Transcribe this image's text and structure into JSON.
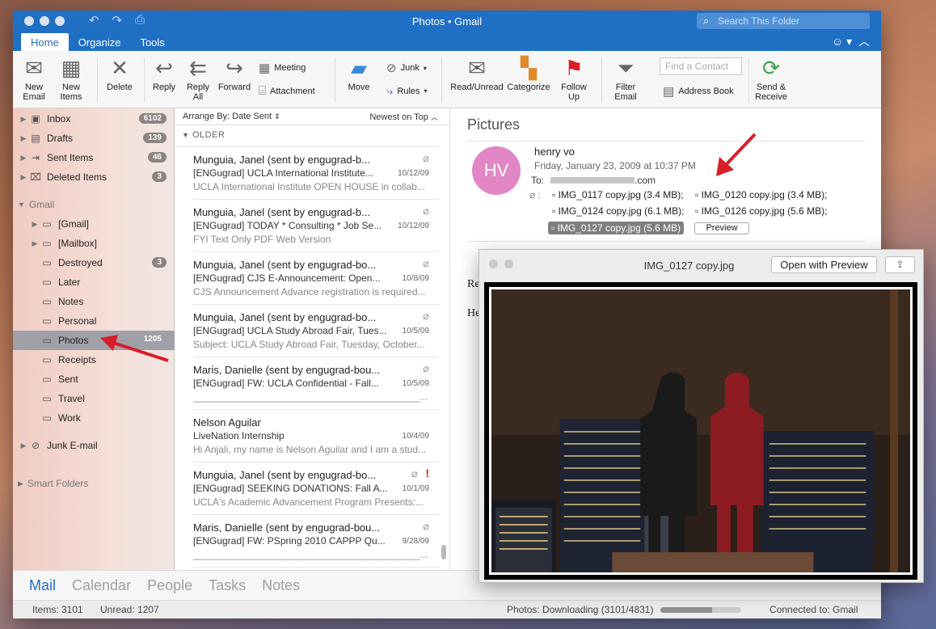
{
  "window": {
    "title": "Photos • Gmail",
    "search_placeholder": "Search This Folder"
  },
  "tabs": [
    "Home",
    "Organize",
    "Tools"
  ],
  "ribbon": {
    "new_email": "New\nEmail",
    "new_items": "New\nItems",
    "delete": "Delete",
    "reply": "Reply",
    "reply_all": "Reply\nAll",
    "forward": "Forward",
    "meeting": "Meeting",
    "attachment": "Attachment",
    "move": "Move",
    "junk": "Junk",
    "rules": "Rules",
    "read_unread": "Read/Unread",
    "categorize": "Categorize",
    "follow_up": "Follow\nUp",
    "filter_email": "Filter\nEmail",
    "find_contact_placeholder": "Find a Contact",
    "address_book": "Address Book",
    "send_receive": "Send &\nReceive"
  },
  "sidebar": {
    "top": [
      {
        "label": "Inbox",
        "count": "6102"
      },
      {
        "label": "Drafts",
        "count": "139"
      },
      {
        "label": "Sent Items",
        "count": "46"
      },
      {
        "label": "Deleted Items",
        "count": "3"
      }
    ],
    "gmail_label": "Gmail",
    "gmail": [
      {
        "label": "[Gmail]",
        "count": ""
      },
      {
        "label": "[Mailbox]",
        "count": ""
      },
      {
        "label": "Destroyed",
        "count": "3"
      },
      {
        "label": "Later",
        "count": ""
      },
      {
        "label": "Notes",
        "count": ""
      },
      {
        "label": "Personal",
        "count": ""
      },
      {
        "label": "Photos",
        "count": "1205"
      },
      {
        "label": "Receipts",
        "count": ""
      },
      {
        "label": "Sent",
        "count": ""
      },
      {
        "label": "Travel",
        "count": ""
      },
      {
        "label": "Work",
        "count": ""
      }
    ],
    "junk": "Junk E-mail",
    "smart": "Smart Folders"
  },
  "list": {
    "arrange": "Arrange By: Date Sent",
    "sort": "Newest on Top",
    "group": "OLDER",
    "messages": [
      {
        "from": "Munguia, Janel (sent by engugrad-b...",
        "subject": "[ENGugrad] UCLA International Institute...",
        "date": "10/12/09",
        "preview": "UCLA International Institute OPEN HOUSE in collab..."
      },
      {
        "from": "Munguia, Janel (sent by engugrad-b...",
        "subject": "[ENGugrad] TODAY * Consulting * Job Se...",
        "date": "10/12/09",
        "preview": "FYI Text Only PDF Web Version"
      },
      {
        "from": "Munguia, Janel (sent by engugrad-bo...",
        "subject": "[ENGugrad] CJS E-Announcement: Open...",
        "date": "10/8/09",
        "preview": "CJS Announcement Advance registration is required..."
      },
      {
        "from": "Munguia, Janel (sent by engugrad-bo...",
        "subject": "[ENGugrad] UCLA Study Abroad Fair, Tues...",
        "date": "10/5/09",
        "preview": "Subject: UCLA Study Abroad Fair, Tuesday, October..."
      },
      {
        "from": "Maris, Danielle (sent by engugrad-bou...",
        "subject": "[ENGugrad] FW: UCLA Confidential - Fall...",
        "date": "10/5/09",
        "preview": "__________________________________________..."
      },
      {
        "from": "Nelson Aguilar",
        "subject": "LiveNation Internship",
        "date": "10/4/09",
        "preview": "Hi Anjali, my name is Nelson Aguilar and I am a stud..."
      },
      {
        "from": "Munguia, Janel (sent by engugrad-bo...",
        "subject": "[ENGugrad] SEEKING DONATIONS: Fall A...",
        "date": "10/1/09",
        "preview": "UCLA's Academic Advancement Program Presents:..."
      },
      {
        "from": "Maris, Danielle (sent by engugrad-bou...",
        "subject": "[ENGugrad] FW: PSpring 2010 CAPPP Qu...",
        "date": "9/28/09",
        "preview": "__________________________________________..."
      }
    ]
  },
  "reading": {
    "subject": "Pictures",
    "initials": "HV",
    "sender": "henry vo",
    "date": "Friday, January 23, 2009 at 10:37 PM",
    "to_label": "To:",
    "to_domain": ".com",
    "attachments": [
      "IMG_0117 copy.jpg (3.4 MB);",
      "IMG_0120 copy.jpg (3.4 MB);",
      "IMG_0124 copy.jpg (6.1 MB);",
      "IMG_0126 copy.jpg (5.6 MB);",
      "IMG_0127 copy.jpg (5.6 MB)"
    ],
    "preview_btn": "Preview",
    "body_frag1": "Re",
    "body_frag2": "He"
  },
  "quicklook": {
    "title": "IMG_0127 copy.jpg",
    "open_button": "Open with Preview"
  },
  "nav": [
    "Mail",
    "Calendar",
    "People",
    "Tasks",
    "Notes"
  ],
  "status": {
    "items": "Items: 3101",
    "unread": "Unread: 1207",
    "download": "Photos: Downloading (3101/4831)",
    "download_progress": 0.64,
    "connected": "Connected to: Gmail"
  },
  "colors": {
    "accent": "#1f6fc5",
    "avatar": "#e286c6",
    "arrow": "#d81e2a"
  }
}
